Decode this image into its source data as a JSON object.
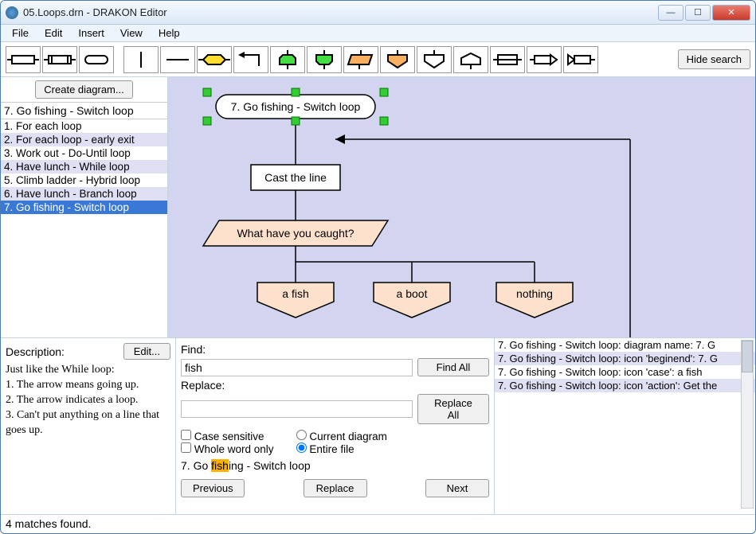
{
  "title": "05.Loops.drn - DRAKON Editor",
  "menu": [
    "File",
    "Edit",
    "Insert",
    "View",
    "Help"
  ],
  "hide_search_label": "Hide search",
  "sidebar": {
    "create_label": "Create diagram...",
    "header": "7. Go fishing - Switch loop",
    "items": [
      {
        "label": "1. For each loop"
      },
      {
        "label": "2. For each loop - early exit"
      },
      {
        "label": "3. Work out - Do-Until loop"
      },
      {
        "label": "4. Have lunch - While loop"
      },
      {
        "label": "5. Climb ladder - Hybrid loop"
      },
      {
        "label": "6. Have lunch - Branch loop"
      },
      {
        "label": "7. Go fishing - Switch loop"
      }
    ]
  },
  "diagram": {
    "title": "7. Go fishing - Switch loop",
    "action": "Cast the line",
    "question": "What have you caught?",
    "cases": [
      "a fish",
      "a boot",
      "nothing"
    ]
  },
  "description": {
    "label": "Description:",
    "edit_label": "Edit...",
    "text": "Just like the While loop:\n1. The arrow means going up.\n2. The arrow indicates a loop.\n3. Can't put anything on a line that goes up."
  },
  "search": {
    "find_label": "Find:",
    "find_value": "fish",
    "find_all": "Find All",
    "replace_label": "Replace:",
    "replace_value": "",
    "replace_all": "Replace All",
    "case_label": "Case sensitive",
    "whole_label": "Whole word only",
    "scope_current": "Current diagram",
    "scope_file": "Entire file",
    "current_prefix": "7. Go ",
    "current_hl": "fish",
    "current_suffix": "ing - Switch loop",
    "prev": "Previous",
    "replace": "Replace",
    "next": "Next"
  },
  "results": [
    "7. Go fishing - Switch loop: diagram name: 7. G",
    "7. Go fishing - Switch loop: icon 'beginend': 7. G",
    "7. Go fishing - Switch loop: icon 'case': a fish",
    "7. Go fishing - Switch loop: icon 'action': Get the"
  ],
  "status": "4 matches found."
}
